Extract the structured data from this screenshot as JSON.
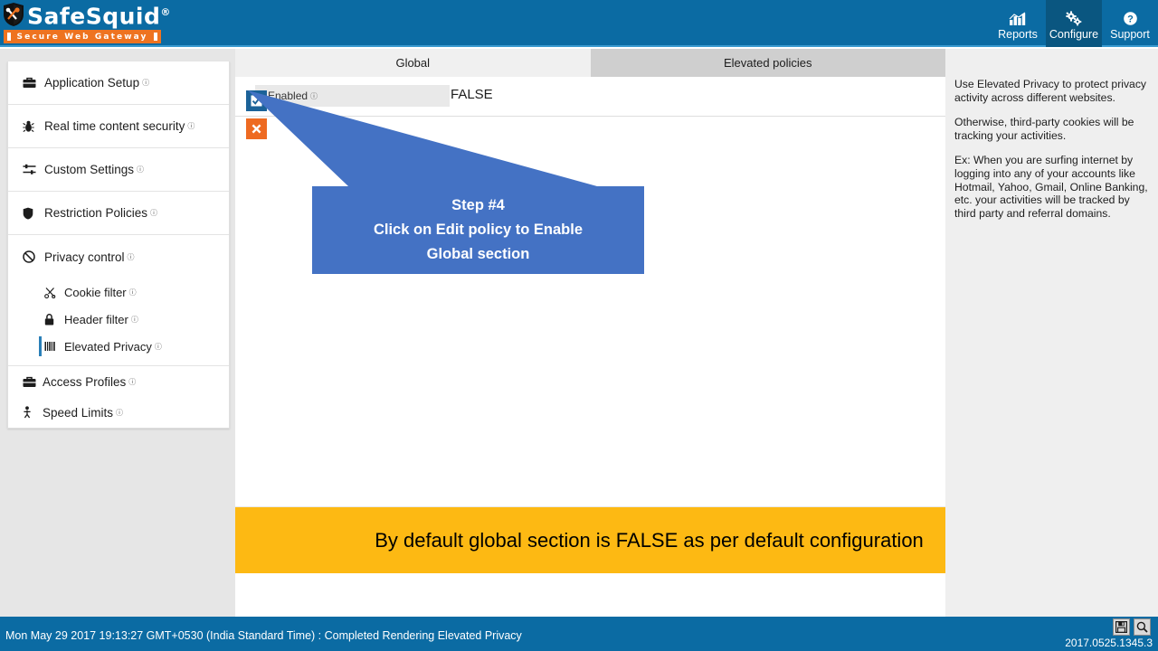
{
  "header": {
    "logo_name": "SafeSquid",
    "logo_reg": "®",
    "logo_tagline": "Secure Web Gateway",
    "nav": [
      {
        "label": "Reports",
        "icon": "chart-icon",
        "active": false
      },
      {
        "label": "Configure",
        "icon": "gears-icon",
        "active": true
      },
      {
        "label": "Support",
        "icon": "help-circle-icon",
        "active": false
      }
    ]
  },
  "sidebar": {
    "items": [
      {
        "label": "Application Setup",
        "icon": "briefcase-icon"
      },
      {
        "label": "Real time content security",
        "icon": "bug-icon"
      },
      {
        "label": "Custom Settings",
        "icon": "sliders-icon"
      },
      {
        "label": "Restriction Policies",
        "icon": "shield-icon"
      },
      {
        "label": "Privacy control",
        "icon": "ban-icon"
      },
      {
        "label": "Cookie filter",
        "icon": "scissors-icon"
      },
      {
        "label": "Header filter",
        "icon": "lock-icon"
      },
      {
        "label": "Elevated Privacy",
        "icon": "barcode-icon"
      },
      {
        "label": "Access Profiles",
        "icon": "briefcase-icon"
      },
      {
        "label": "Speed Limits",
        "icon": "person-icon"
      }
    ],
    "info_glyph": "ⓘ"
  },
  "main": {
    "tabs": [
      {
        "label": "Global",
        "active": true
      },
      {
        "label": "Elevated policies",
        "active": false
      }
    ],
    "field_label": "Enabled",
    "field_value": "FALSE",
    "edit_button_title": "Edit policy",
    "delete_button_title": "Delete policy",
    "callout": {
      "line1": "Step #4",
      "line2": "Click on Edit policy to Enable",
      "line3": "Global section"
    },
    "banner_text": "By default global section is FALSE as per default configuration"
  },
  "help": {
    "paragraphs": [
      "Use Elevated Privacy to protect privacy activity across different websites.",
      "Otherwise, third-party cookies will be tracking your activities.",
      "Ex: When you are surfing internet by logging into any of your accounts like Hotmail, Yahoo, Gmail, Online Banking, etc. your activities will be tracked by third party and referral domains."
    ]
  },
  "statusbar": {
    "message": "Mon May 29 2017 19:13:27 GMT+0530 (India Standard Time) : Completed Rendering Elevated Privacy",
    "version": "2017.0525.1345.3",
    "icons": [
      {
        "name": "save-icon",
        "title": "Save"
      },
      {
        "name": "search-icon",
        "title": "Search"
      }
    ]
  },
  "colors": {
    "brand_blue": "#0b6ba3",
    "brand_blue_dark": "#0a5680",
    "orange": "#ee7320",
    "callout_blue": "#4472c4",
    "banner_yellow": "#fdb913",
    "edit_blue": "#1b6298",
    "delete_orange": "#ee6a21"
  }
}
